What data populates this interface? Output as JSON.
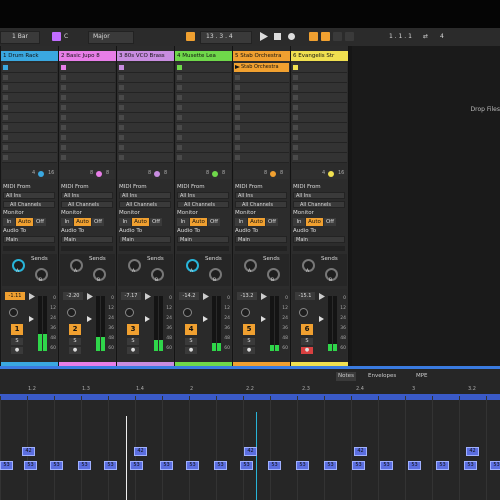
{
  "toolbar": {
    "quantize": "1 Bar",
    "key": "C",
    "scale": "Major",
    "position": "13 . 3 . 4",
    "loop_start": "1 . 1 . 1",
    "loop_len": "4",
    "accent": "#f0a030"
  },
  "tracks": [
    {
      "name": "1 Drum Rack",
      "color": "#3aa8e0",
      "clip": "",
      "ch_label": "4",
      "ch_num": "16",
      "vol": "-1.11",
      "num": "1",
      "meter": 0.3
    },
    {
      "name": "2 Basic Jupo 8",
      "color": "#e87ee8",
      "clip": "",
      "ch_label": "8",
      "ch_num": "8",
      "vol": "-2.20",
      "num": "2",
      "meter": 0.25
    },
    {
      "name": "3 80s VCO Brass",
      "color": "#c88de0",
      "clip": "",
      "ch_label": "8",
      "ch_num": "8",
      "vol": "-7.17",
      "num": "3",
      "meter": 0.2
    },
    {
      "name": "4 Musette Lea",
      "color": "#6fd84a",
      "clip": "",
      "ch_label": "8",
      "ch_num": "8",
      "vol": "-14.2",
      "num": "4",
      "meter": 0.15
    },
    {
      "name": "5 Stab Orchestra",
      "color": "#f0a030",
      "clip": "Stab Orchestra",
      "ch_label": "8",
      "ch_num": "8",
      "vol": "-13.2",
      "num": "5",
      "meter": 0.1
    },
    {
      "name": "6 Evangelis Str",
      "color": "#f0e050",
      "clip": "",
      "ch_label": "4",
      "ch_num": "16",
      "vol": "-15.1",
      "num": "6",
      "meter": 0.12
    }
  ],
  "io": {
    "midi_from": "MIDI From",
    "all_ins": "All Ins",
    "all_channels": "All Channels",
    "monitor": "Monitor",
    "in": "In",
    "auto": "Auto",
    "off": "Off",
    "audio_to": "Audio To",
    "main": "Main",
    "sends": "Sends",
    "a": "A",
    "b": "B",
    "s": "S"
  },
  "db_scale": [
    "0",
    "12",
    "24",
    "36",
    "48",
    "60"
  ],
  "right_panel": {
    "drop_text": "Drop Files"
  },
  "detail": {
    "tabs": [
      "Notes",
      "Envelopes",
      "MPE"
    ],
    "ruler": [
      "1.2",
      "1.3",
      "1.4",
      "2",
      "2.2",
      "2.3",
      "2.4",
      "3",
      "3.2"
    ],
    "note_high": "42",
    "note_low": "53"
  }
}
